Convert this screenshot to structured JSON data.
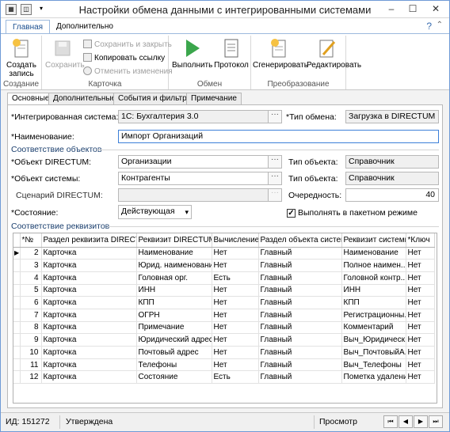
{
  "window": {
    "title": "Настройки обмена данными с интегрированными системами",
    "controls": [
      "–",
      "☐",
      "✕"
    ]
  },
  "ribbon": {
    "tabs": [
      "Главная",
      "Дополнительно"
    ],
    "create": {
      "label": "Создать запись",
      "group": "Создание"
    },
    "card": {
      "save": "Сохранить",
      "save_close": "Сохранить и закрыть",
      "copy_link": "Копировать ссылку",
      "undo": "Отменить изменения",
      "group": "Карточка"
    },
    "exchange": {
      "run": "Выполнить",
      "log": "Протокол",
      "group": "Обмен"
    },
    "transform": {
      "generate": "Сгенерировать",
      "edit": "Редактировать",
      "group": "Преобразование"
    }
  },
  "form_tabs": [
    "Основные",
    "Дополнительные",
    "События и фильтры",
    "Примечание"
  ],
  "form": {
    "int_system_label": "*Интегрированная система:",
    "int_system_value": "1С: Бухгалтерия 3.0",
    "exchange_type_label": "*Тип обмена:",
    "exchange_type_value": "Загрузка в DIRECTUM",
    "name_label": "*Наименование:",
    "name_value": "Импорт Организаций",
    "objects_section": "Соответствие объектов",
    "dir_object_label": "*Объект DIRECTUM:",
    "dir_object_value": "Организации",
    "obj_type_label": "Тип объекта:",
    "obj_type1_value": "Справочник",
    "sys_object_label": "*Объект системы:",
    "sys_object_value": "Контрагенты",
    "obj_type2_value": "Справочник",
    "scenario_label": "Сценарий DIRECTUM:",
    "scenario_value": "",
    "order_label": "Очередность:",
    "order_value": "40",
    "state_label": "*Состояние:",
    "state_value": "Действующая",
    "batch_label": "Выполнять в пакетном режиме",
    "batch_checked": true
  },
  "requisites": {
    "section": "Соответствие реквизитов",
    "columns": [
      "*№",
      "Раздел реквизита DIRECTUM",
      "Реквизит DIRECTUM",
      "Вычисление",
      "Раздел объекта системы",
      "Реквизит системы",
      "*Ключ"
    ],
    "rows": [
      [
        "2",
        "Карточка",
        "Наименование",
        "Нет",
        "Главный",
        "Наименование",
        "Нет"
      ],
      [
        "3",
        "Карточка",
        "Юрид. наименование",
        "Нет",
        "Главный",
        "Полное наимен...",
        "Нет"
      ],
      [
        "4",
        "Карточка",
        "Головная орг.",
        "Есть",
        "Главный",
        "Головной контр...",
        "Нет"
      ],
      [
        "5",
        "Карточка",
        "ИНН",
        "Нет",
        "Главный",
        "ИНН",
        "Нет"
      ],
      [
        "6",
        "Карточка",
        "КПП",
        "Нет",
        "Главный",
        "КПП",
        "Нет"
      ],
      [
        "7",
        "Карточка",
        "ОГРН",
        "Нет",
        "Главный",
        "Регистрационны...",
        "Нет"
      ],
      [
        "8",
        "Карточка",
        "Примечание",
        "Нет",
        "Главный",
        "Комментарий",
        "Нет"
      ],
      [
        "9",
        "Карточка",
        "Юридический адрес",
        "Нет",
        "Главный",
        "Выч_Юридическ...",
        "Нет"
      ],
      [
        "10",
        "Карточка",
        "Почтовый адрес",
        "Нет",
        "Главный",
        "Выч_ПочтовыйА...",
        "Нет"
      ],
      [
        "11",
        "Карточка",
        "Телефоны",
        "Нет",
        "Главный",
        "Выч_Телефоны",
        "Нет"
      ],
      [
        "12",
        "Карточка",
        "Состояние",
        "Есть",
        "Главный",
        "Пометка удаления",
        "Нет"
      ]
    ]
  },
  "status": {
    "id": "ИД: 151272",
    "state": "Утверждена",
    "mode": "Просмотр"
  }
}
